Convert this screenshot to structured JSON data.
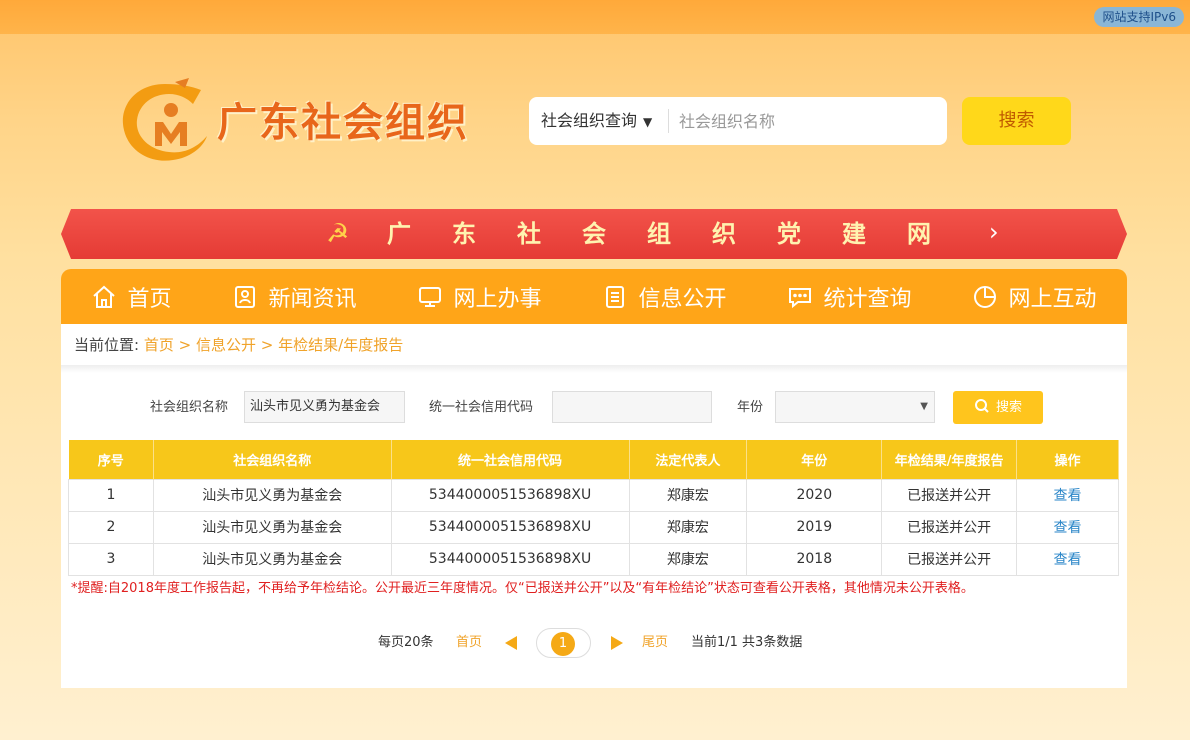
{
  "header": {
    "ipv6_badge": "网站支持IPv6",
    "logo_text": "广东社会组织",
    "search": {
      "type_selected": "社会组织查询",
      "placeholder": "社会组织名称",
      "value": "",
      "button": "搜索"
    }
  },
  "party_banner": {
    "text": "广东社会组织党建网"
  },
  "nav": [
    {
      "label": "首页",
      "icon": "home-icon"
    },
    {
      "label": "新闻资讯",
      "icon": "news-icon"
    },
    {
      "label": "网上办事",
      "icon": "monitor-icon"
    },
    {
      "label": "信息公开",
      "icon": "document-icon"
    },
    {
      "label": "统计查询",
      "icon": "chat-icon"
    },
    {
      "label": "网上互动",
      "icon": "pie-icon"
    }
  ],
  "breadcrumb": {
    "prefix": "当前位置:",
    "home": "首页",
    "sep": ">",
    "level1": "信息公开",
    "level2": "年检结果/年度报告"
  },
  "filter": {
    "name_label": "社会组织名称",
    "name_value": "汕头市见义勇为基金会",
    "code_label": "统一社会信用代码",
    "code_value": "",
    "year_label": "年份",
    "year_value": "",
    "button": "搜索"
  },
  "table": {
    "headers": [
      "序号",
      "社会组织名称",
      "统一社会信用代码",
      "法定代表人",
      "年份",
      "年检结果/年度报告",
      "操作"
    ],
    "rows": [
      {
        "idx": "1",
        "name": "汕头市见义勇为基金会",
        "code": "5344000051536898XU",
        "rep": "郑康宏",
        "year": "2020",
        "status": "已报送并公开",
        "action": "查看"
      },
      {
        "idx": "2",
        "name": "汕头市见义勇为基金会",
        "code": "5344000051536898XU",
        "rep": "郑康宏",
        "year": "2019",
        "status": "已报送并公开",
        "action": "查看"
      },
      {
        "idx": "3",
        "name": "汕头市见义勇为基金会",
        "code": "5344000051536898XU",
        "rep": "郑康宏",
        "year": "2018",
        "status": "已报送并公开",
        "action": "查看"
      }
    ]
  },
  "notice": "*提醒:自2018年度工作报告起，不再给予年检结论。公开最近三年度情况。仅“已报送并公开”以及“有年检结论”状态可查看公开表格，其他情况未公开表格。",
  "pager": {
    "per_page": "每页20条",
    "first": "首页",
    "current": "1",
    "last": "尾页",
    "summary": "当前1/1 共3条数据"
  },
  "colors": {
    "accent": "#ffa518",
    "table_header": "#f7c71a",
    "link": "#2a86c8",
    "notice": "#e02020"
  }
}
